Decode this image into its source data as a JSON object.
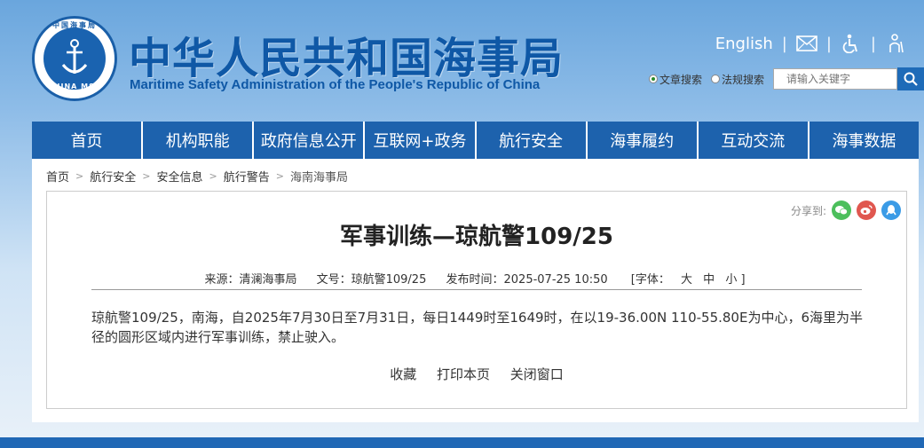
{
  "header": {
    "title_cn": "中华人民共和国海事局",
    "title_en": "Maritime Safety Administration of the People's Republic of China",
    "logo_top": "中国海事局",
    "logo_bottom": "CHINA MSA",
    "english_link": "English",
    "icons": [
      "mail-icon",
      "accessibility-icon",
      "elderly-mode-icon"
    ]
  },
  "search": {
    "option_articles": "文章搜索",
    "option_laws": "法规搜索",
    "placeholder": "请输入关键字"
  },
  "nav": {
    "items": [
      "首页",
      "机构职能",
      "政府信息公开",
      "互联网+政务",
      "航行安全",
      "海事履约",
      "互动交流",
      "海事数据"
    ]
  },
  "breadcrumb": {
    "items": [
      "首页",
      "航行安全",
      "安全信息",
      "航行警告",
      "海南海事局"
    ]
  },
  "article": {
    "share_label": "分享到:",
    "title": "军事训练—琼航警109/25",
    "source": "来源：清澜海事局",
    "doc_no": "文号：琼航警109/25",
    "publish_time": "发布时间：2025-07-25 10:50",
    "font_label": "[字体：",
    "font_large": "大",
    "font_medium": "中",
    "font_small": "小 ]",
    "body": "琼航警109/25，南海，自2025年7月30日至7月31日，每日1449时至1649时，在以19-36.00N 110-55.80E为中心，6海里为半径的圆形区域内进行军事训练，禁止驶入。",
    "action_favorite": "收藏",
    "action_print": "打印本页",
    "action_close": "关闭窗口"
  },
  "colors": {
    "brand_blue": "#1d62ad",
    "wechat_green": "#4cbf5c",
    "weibo_red": "#e0574f",
    "qq_blue": "#3b9be6"
  }
}
